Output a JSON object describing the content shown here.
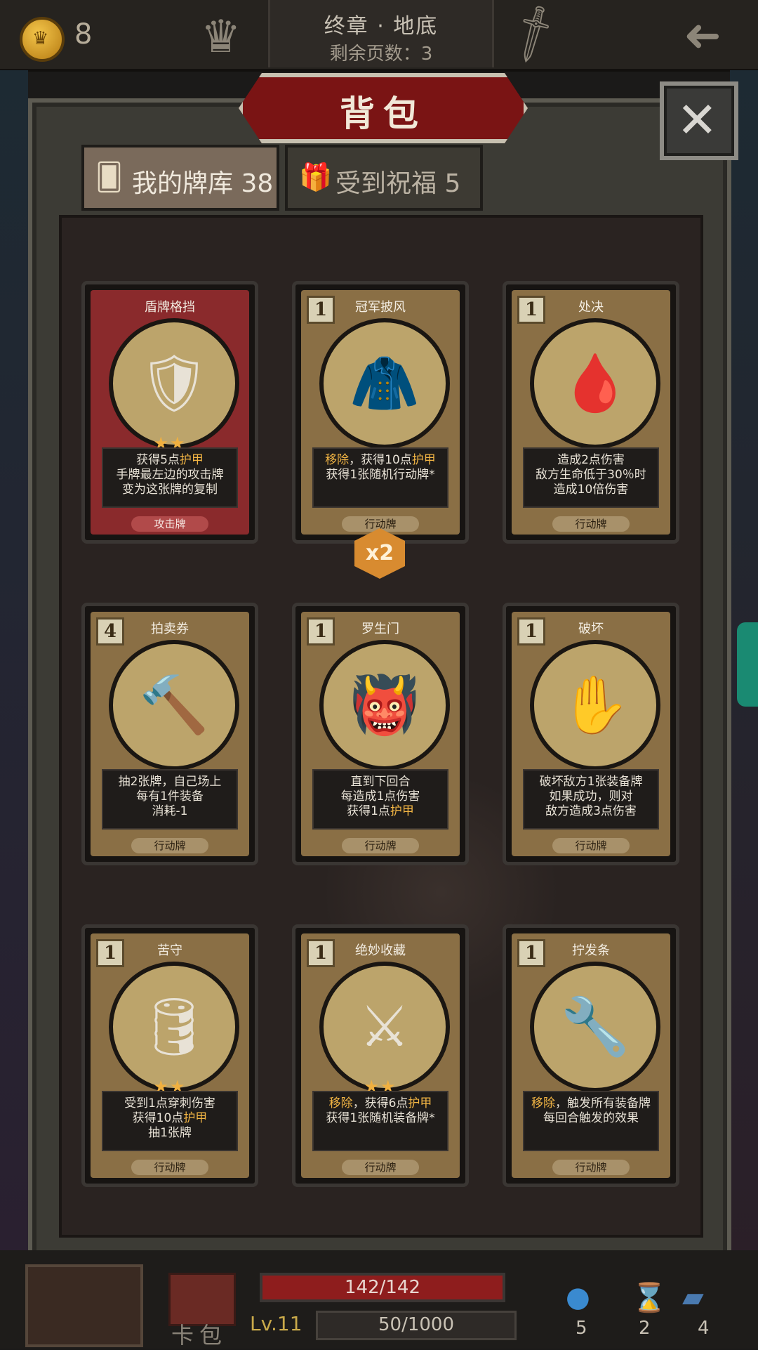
{
  "topbar": {
    "coin_symbol": "♛",
    "coin_count": "8",
    "crown_icon": "♛",
    "chapter_title": "终章 · 地底",
    "chapter_pages": "剩余页数：3",
    "sword_icon": "🗡",
    "back_icon": "➜"
  },
  "panel": {
    "title": "背包",
    "close_icon": "✕"
  },
  "tabs": [
    {
      "icon": "🂠",
      "label": "我的牌库 38"
    },
    {
      "icon": "🎁",
      "label": "受到祝福 5"
    }
  ],
  "cards": [
    {
      "title": "盾牌格挡",
      "cost": "",
      "stars": "★★",
      "art": "🛡",
      "lines": [
        [
          "获得5点",
          "护甲"
        ],
        [
          "手牌最左边的攻击牌"
        ],
        [
          "变为这张牌的复制"
        ]
      ],
      "type": "攻击牌"
    },
    {
      "title": "冠军披风",
      "cost": "1",
      "stars": "",
      "art": "🧥",
      "lines": [
        [
          "移除",
          "，获得10点",
          "护甲"
        ],
        [
          "获得1张随机行动牌*"
        ]
      ],
      "type": "行动牌"
    },
    {
      "title": "处决",
      "cost": "1",
      "stars": "",
      "art": "🩸",
      "lines": [
        [
          "造成2点伤害"
        ],
        [
          "敌方生命低于30％时"
        ],
        [
          "造成10倍伤害"
        ]
      ],
      "type": "行动牌"
    },
    {
      "title": "拍卖券",
      "cost": "4",
      "stars": "",
      "art": "🔨",
      "lines": [
        [
          "抽2张牌，自己场上"
        ],
        [
          "每有1件装备"
        ],
        [
          "消耗-1"
        ]
      ],
      "type": "行动牌"
    },
    {
      "title": "罗生门",
      "cost": "1",
      "stars": "",
      "art": "👹",
      "lines": [
        [
          "直到下回合"
        ],
        [
          "每造成1点伤害"
        ],
        [
          "获得1点",
          "护甲"
        ]
      ],
      "type": "行动牌"
    },
    {
      "title": "破坏",
      "cost": "1",
      "stars": "",
      "art": "✋",
      "lines": [
        [
          "破坏敌方1张装备牌"
        ],
        [
          "如果成功，则对"
        ],
        [
          "敌方造成3点伤害"
        ]
      ],
      "type": "行动牌"
    },
    {
      "title": "苦守",
      "cost": "1",
      "stars": "★★",
      "art": "🛢",
      "lines": [
        [
          "受到1点穿刺伤害"
        ],
        [
          "获得10点",
          "护甲"
        ],
        [
          "抽1张牌"
        ]
      ],
      "type": "行动牌"
    },
    {
      "title": "绝妙收藏",
      "cost": "1",
      "stars": "★★",
      "art": "⚔",
      "lines": [
        [
          "移除",
          "，获得6点",
          "护甲"
        ],
        [
          "获得1张随机装备牌*"
        ]
      ],
      "type": "行动牌"
    },
    {
      "title": "拧发条",
      "cost": "1",
      "stars": "",
      "art": "🔧",
      "lines": [
        [
          "移除",
          "，触发所有装备牌"
        ],
        [
          "每回合触发的效果"
        ]
      ],
      "type": "行动牌"
    }
  ],
  "badge_x2": "x2",
  "bottom": {
    "hp": "142/142",
    "hp_fraction": 1.0,
    "level": "Lv.11",
    "xp": "50/1000",
    "xp_fraction": 0.05,
    "card_pack": "卡包",
    "potion_count": "5",
    "hourglass_count": "2",
    "cards_count": "4"
  }
}
